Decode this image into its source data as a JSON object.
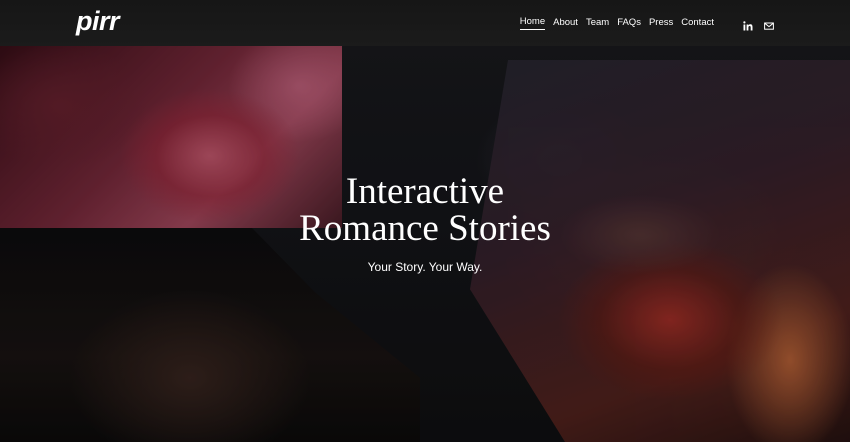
{
  "brand": {
    "logo_text": "pirr"
  },
  "nav": {
    "items": [
      {
        "label": "Home",
        "active": true
      },
      {
        "label": "About"
      },
      {
        "label": "Team"
      },
      {
        "label": "FAQs"
      },
      {
        "label": "Press"
      },
      {
        "label": "Contact"
      }
    ],
    "social_icons": [
      "linkedin-icon",
      "email-icon"
    ]
  },
  "hero": {
    "title_line1": "Interactive",
    "title_line2": "Romance Stories",
    "subtitle": "Your Story. Your Way."
  },
  "colors": {
    "text": "#ffffff",
    "header_bg": "#1a1a1a"
  }
}
